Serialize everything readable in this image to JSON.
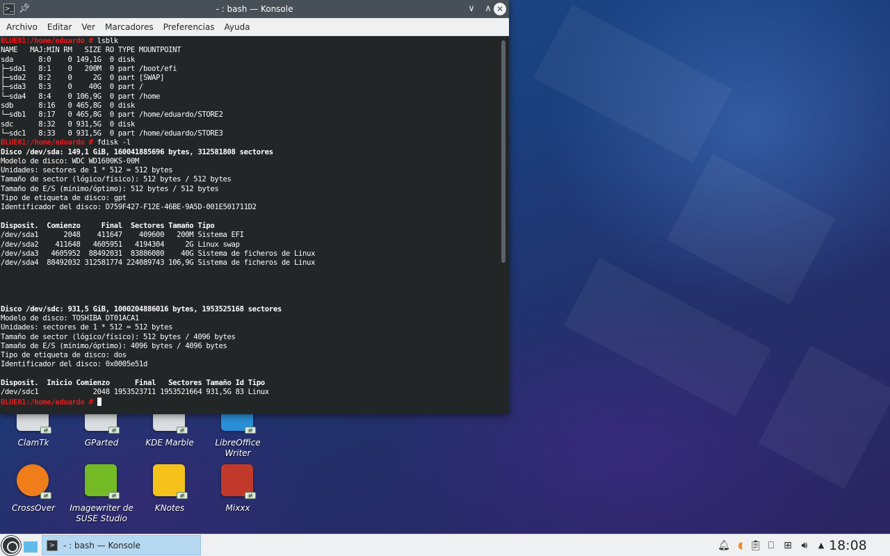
{
  "window": {
    "title": "- : bash — Konsole",
    "menu": [
      "Archivo",
      "Editar",
      "Ver",
      "Marcadores",
      "Preferencias",
      "Ayuda"
    ]
  },
  "terminal": {
    "lines": [
      {
        "type": "prompt",
        "prompt": "BLUE01:/home/eduardo #",
        "cmd": " lsblk"
      },
      {
        "type": "text",
        "text": "NAME   MAJ:MIN RM   SIZE RO TYPE MOUNTPOINT"
      },
      {
        "type": "text",
        "text": "sda      8:0    0 149,1G  0 disk"
      },
      {
        "type": "text",
        "text": "├─sda1   8:1    0   200M  0 part /boot/efi"
      },
      {
        "type": "text",
        "text": "├─sda2   8:2    0     2G  0 part [SWAP]"
      },
      {
        "type": "text",
        "text": "├─sda3   8:3    0    40G  0 part /"
      },
      {
        "type": "text",
        "text": "└─sda4   8:4    0 106,9G  0 part /home"
      },
      {
        "type": "text",
        "text": "sdb      8:16   0 465,8G  0 disk"
      },
      {
        "type": "text",
        "text": "└─sdb1   8:17   0 465,8G  0 part /home/eduardo/STORE2"
      },
      {
        "type": "text",
        "text": "sdc      8:32   0 931,5G  0 disk"
      },
      {
        "type": "text",
        "text": "└─sdc1   8:33   0 931,5G  0 part /home/eduardo/STORE3"
      },
      {
        "type": "prompt",
        "prompt": "BLUE01:/home/eduardo #",
        "cmd": " fdisk -l"
      },
      {
        "type": "bold",
        "text": "Disco /dev/sda: 149,1 GiB, 160041885696 bytes, 312581808 sectores"
      },
      {
        "type": "text",
        "text": "Modelo de disco: WDC WD1600KS-00M"
      },
      {
        "type": "text",
        "text": "Unidades: sectores de 1 * 512 = 512 bytes"
      },
      {
        "type": "text",
        "text": "Tamaño de sector (lógico/físico): 512 bytes / 512 bytes"
      },
      {
        "type": "text",
        "text": "Tamaño de E/S (mínimo/óptimo): 512 bytes / 512 bytes"
      },
      {
        "type": "text",
        "text": "Tipo de etiqueta de disco: gpt"
      },
      {
        "type": "text",
        "text": "Identificador del disco: D759F427-F12E-46BE-9A5D-001E501711D2"
      },
      {
        "type": "text",
        "text": ""
      },
      {
        "type": "bold",
        "text": "Disposit.  Comienzo     Final  Sectores Tamaño Tipo"
      },
      {
        "type": "text",
        "text": "/dev/sda1      2048    411647    409600   200M Sistema EFI"
      },
      {
        "type": "text",
        "text": "/dev/sda2    411648   4605951   4194304     2G Linux swap"
      },
      {
        "type": "text",
        "text": "/dev/sda3   4605952  88492031  83886080    40G Sistema de ficheros de Linux"
      },
      {
        "type": "text",
        "text": "/dev/sda4  88492032 312581774 224089743 106,9G Sistema de ficheros de Linux"
      },
      {
        "type": "text",
        "text": ""
      },
      {
        "type": "text",
        "text": ""
      },
      {
        "type": "text",
        "text": ""
      },
      {
        "type": "text",
        "text": ""
      },
      {
        "type": "bold",
        "text": "Disco /dev/sdc: 931,5 GiB, 1000204886016 bytes, 1953525168 sectores"
      },
      {
        "type": "text",
        "text": "Modelo de disco: TOSHIBA DT01ACA1"
      },
      {
        "type": "text",
        "text": "Unidades: sectores de 1 * 512 = 512 bytes"
      },
      {
        "type": "text",
        "text": "Tamaño de sector (lógico/físico): 512 bytes / 4096 bytes"
      },
      {
        "type": "text",
        "text": "Tamaño de E/S (mínimo/óptimo): 4096 bytes / 4096 bytes"
      },
      {
        "type": "text",
        "text": "Tipo de etiqueta de disco: dos"
      },
      {
        "type": "text",
        "text": "Identificador del disco: 0x0005e51d"
      },
      {
        "type": "text",
        "text": ""
      },
      {
        "type": "bold",
        "text": "Disposit.  Inicio Comienzo      Final   Sectores Tamaño Id Tipo"
      },
      {
        "type": "text",
        "text": "/dev/sdc1             2048 1953523711 1953521664 931,5G 83 Linux"
      },
      {
        "type": "prompt",
        "prompt": "BLUE01:/home/eduardo #",
        "cmd": " ",
        "cursor": true
      }
    ]
  },
  "desktop": {
    "icons": [
      {
        "label": "ClamTk",
        "icon": "clamtk-icon",
        "color": "#d9dde0"
      },
      {
        "label": "GParted",
        "icon": "gparted-icon",
        "color": "#d9dde0"
      },
      {
        "label": "KDE Marble",
        "icon": "marble-icon",
        "color": "#d9dde0"
      },
      {
        "label": "LibreOffice Writer",
        "icon": "writer-icon",
        "color": "#2a8fd6"
      },
      {
        "label": "CrossOver",
        "icon": "crossover-icon",
        "color": "#ef7d1a"
      },
      {
        "label": "Imagewriter de SUSE Studio",
        "icon": "imagewriter-icon",
        "color": "#73ba25"
      },
      {
        "label": "KNotes",
        "icon": "knotes-icon",
        "color": "#f5c21b"
      },
      {
        "label": "Mixxx",
        "icon": "mixxx-icon",
        "color": "#c0392b"
      }
    ]
  },
  "taskbar": {
    "task_label": "- : bash — Konsole",
    "clock": "18:08",
    "tray": [
      "notifications-icon",
      "redshift-icon",
      "clipboard-icon",
      "usb-icon",
      "network-icon",
      "volume-icon",
      "expand-tray-icon"
    ]
  },
  "colors": {
    "prompt": "#ed1515",
    "terminal_bg": "#232627",
    "titlebar": "#475057",
    "accent": "#3daee9"
  }
}
